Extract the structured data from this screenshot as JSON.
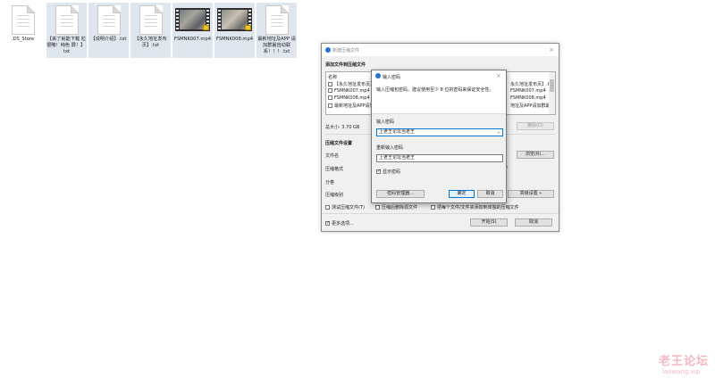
{
  "desktop": {
    "files": [
      {
        "name": ".DS_Store",
        "type": "doc"
      },
      {
        "name": "【来了就能下载 粒很嗷！纯色 屏！】.txt",
        "type": "doc"
      },
      {
        "name": "【说明介绍】.txt",
        "type": "doc"
      },
      {
        "name": "【永久地址发布 页】.txt",
        "type": "doc"
      },
      {
        "name": "FSMNK007.mp4",
        "type": "video"
      },
      {
        "name": "FSMNK008.mp4",
        "type": "video"
      },
      {
        "name": "最新地址及APP 请加群最自动联 系！！！.txt",
        "type": "doc"
      }
    ]
  },
  "archive_window": {
    "title": "新建压缩文件",
    "section_add": "添加文件到压缩文件",
    "list_header": "名称",
    "list_items": [
      "【永久地址发布页】",
      "FSMNK007.mp4",
      "FSMNK008.mp4",
      "最新地址及APP请加"
    ],
    "right_list_items": [
      "永久地址发布页】.txt",
      "FSMNK007.mp4",
      "FSMNK008.mp4",
      "地址及APP请加群最"
    ],
    "total_size": "总大小: 3.70 GB",
    "delete_button": "删除(D)",
    "section_settings": "压缩文件设置",
    "filename_label": "文件名",
    "browse_button": "浏览(R)...",
    "format_label": "压缩格式",
    "split_label": "分卷",
    "level_label": "压缩级别",
    "advanced_button": "高级设置 »",
    "test_option": "测试压缩文件(T)",
    "delete_source_option": "压缩后删除源文件",
    "separate_option": "把每个文件/文件夹添加到单独的压缩文件",
    "more_options": "更多选项...",
    "start_button": "开始(S)",
    "cancel_button": "取消"
  },
  "password_dialog": {
    "title": "输入密码",
    "hint": "输入压缩包密码，建议使用至少 8 位的密码来保证安全性。",
    "password_label": "输入密码",
    "password_value": "上老王论坛当老王",
    "confirm_label": "重新输入密码",
    "confirm_value": "上老王论坛当老王",
    "show_password": "显示密码",
    "manager_button": "密码管理器...",
    "ok_button": "确定",
    "cancel_button": "取消"
  },
  "watermark": {
    "text": "老王论坛",
    "url": "laowang.vip"
  }
}
